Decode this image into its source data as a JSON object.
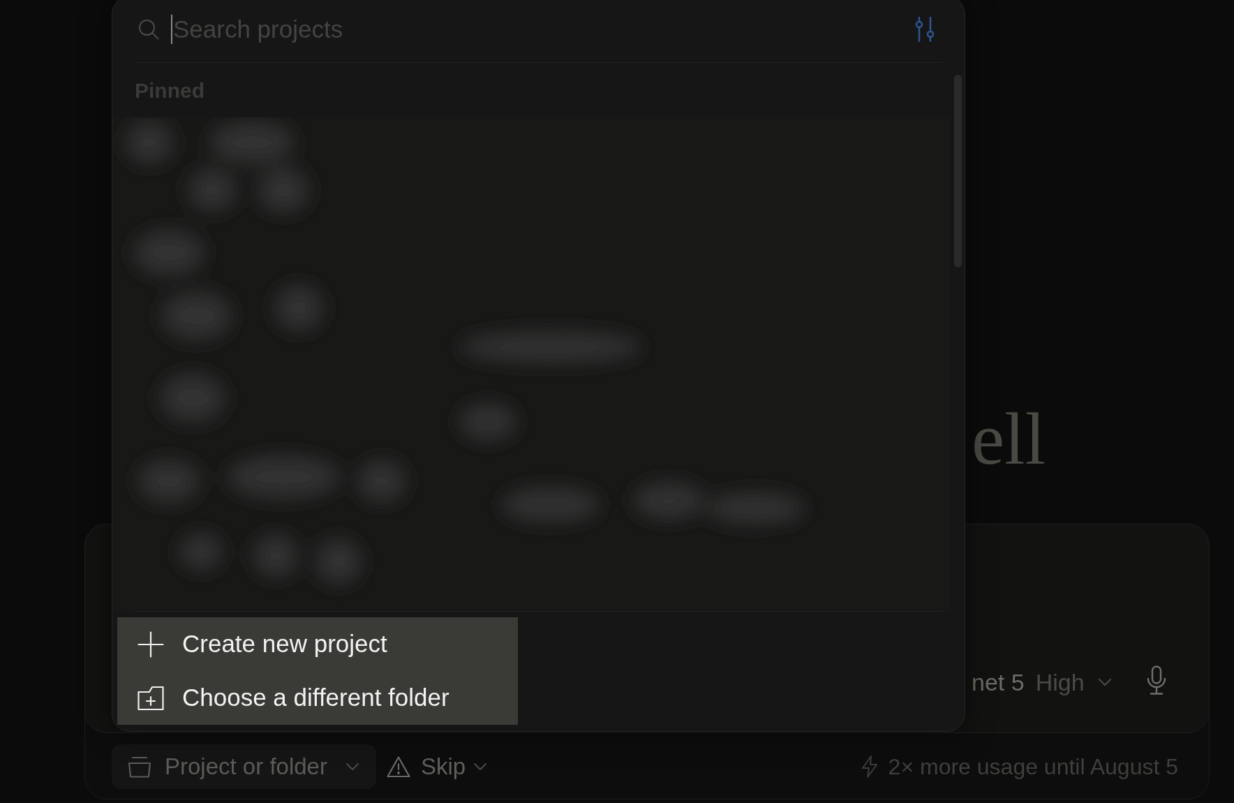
{
  "project_picker": {
    "search": {
      "placeholder": "Search projects"
    },
    "section_label": "Pinned",
    "actions": [
      {
        "kind": "create",
        "label": "Create new project"
      },
      {
        "kind": "folder",
        "label": "Choose a different folder"
      }
    ]
  },
  "greeting": {
    "text": "ell"
  },
  "composer": {
    "model": "net 5",
    "effort": "High"
  },
  "footer": {
    "project_button": "Project or folder",
    "permission": "Skip",
    "usage_notice": "2× more usage until August 5"
  }
}
